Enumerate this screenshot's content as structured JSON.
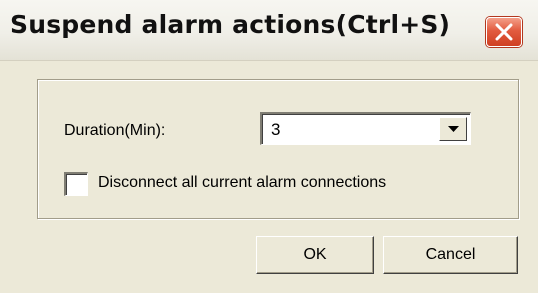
{
  "window": {
    "title": "Suspend alarm actions(Ctrl+S)"
  },
  "titlebar": {
    "close_icon": "close-icon",
    "close_color": "#e25b3f"
  },
  "form": {
    "duration_label": "Duration(Min):",
    "duration_value": "3",
    "dropdown_icon": "chevron-down-icon",
    "disconnect_label": "Disconnect all current alarm connections",
    "disconnect_checked": false
  },
  "buttons": {
    "ok_label": "OK",
    "cancel_label": "Cancel"
  }
}
